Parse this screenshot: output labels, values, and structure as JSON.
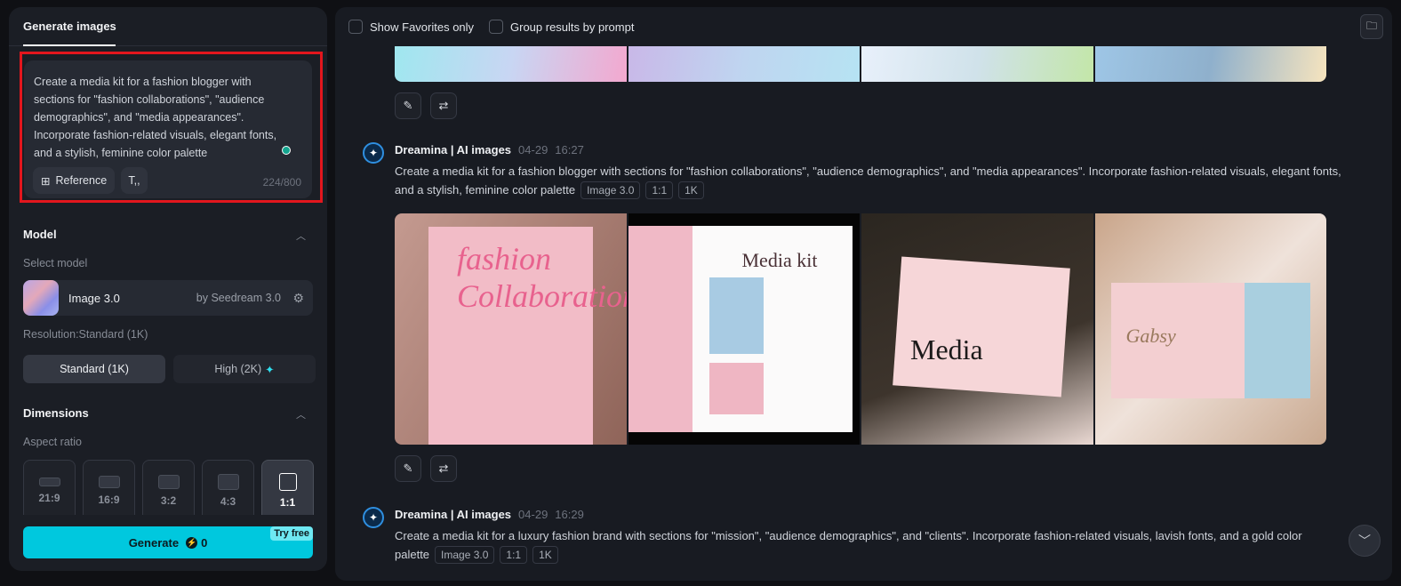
{
  "sidebar": {
    "tab": "Generate images",
    "prompt": "Create a media kit for a fashion blogger with sections for \"fashion collaborations\", \"audience demographics\", and \"media appearances\". Incorporate fashion-related visuals, elegant fonts, and a stylish, feminine color palette",
    "reference_label": "Reference",
    "char_count": "224/800",
    "model_section": "Model",
    "select_model_label": "Select model",
    "model_name": "Image 3.0",
    "model_by": "by Seedream 3.0",
    "resolution_label": "Resolution:Standard (1K)",
    "res_standard": "Standard (1K)",
    "res_high": "High (2K)",
    "dimensions_section": "Dimensions",
    "aspect_label": "Aspect ratio",
    "aspect_ratios": [
      "21:9",
      "16:9",
      "3:2",
      "4:3",
      "1:1"
    ],
    "selected_aspect": "1:1",
    "generate_label": "Generate",
    "credits": "0",
    "try_free": "Try free"
  },
  "toolbar": {
    "favorites": "Show Favorites only",
    "group": "Group results by prompt"
  },
  "results": [
    {
      "author": "Dreamina | AI images",
      "date": "04-29",
      "time": "16:27",
      "prompt": "Create a media kit for a fashion blogger with sections for \"fashion collaborations\", \"audience demographics\", and \"media appearances\". Incorporate fashion-related visuals, elegant fonts, and a stylish, feminine color palette",
      "tags": [
        "Image 3.0",
        "1:1",
        "1K"
      ],
      "image_texts": [
        "fashion Collaborations",
        "Media kit",
        "Media",
        "Gabsy"
      ]
    },
    {
      "author": "Dreamina | AI images",
      "date": "04-29",
      "time": "16:29",
      "prompt": "Create a media kit for a luxury fashion brand with sections for \"mission\", \"audience demographics\", and \"clients\". Incorporate fashion-related visuals, lavish fonts, and a gold color palette",
      "tags": [
        "Image 3.0",
        "1:1",
        "1K"
      ]
    }
  ],
  "colors": {
    "accent": "#00c8de",
    "highlight": "#e3161d"
  }
}
